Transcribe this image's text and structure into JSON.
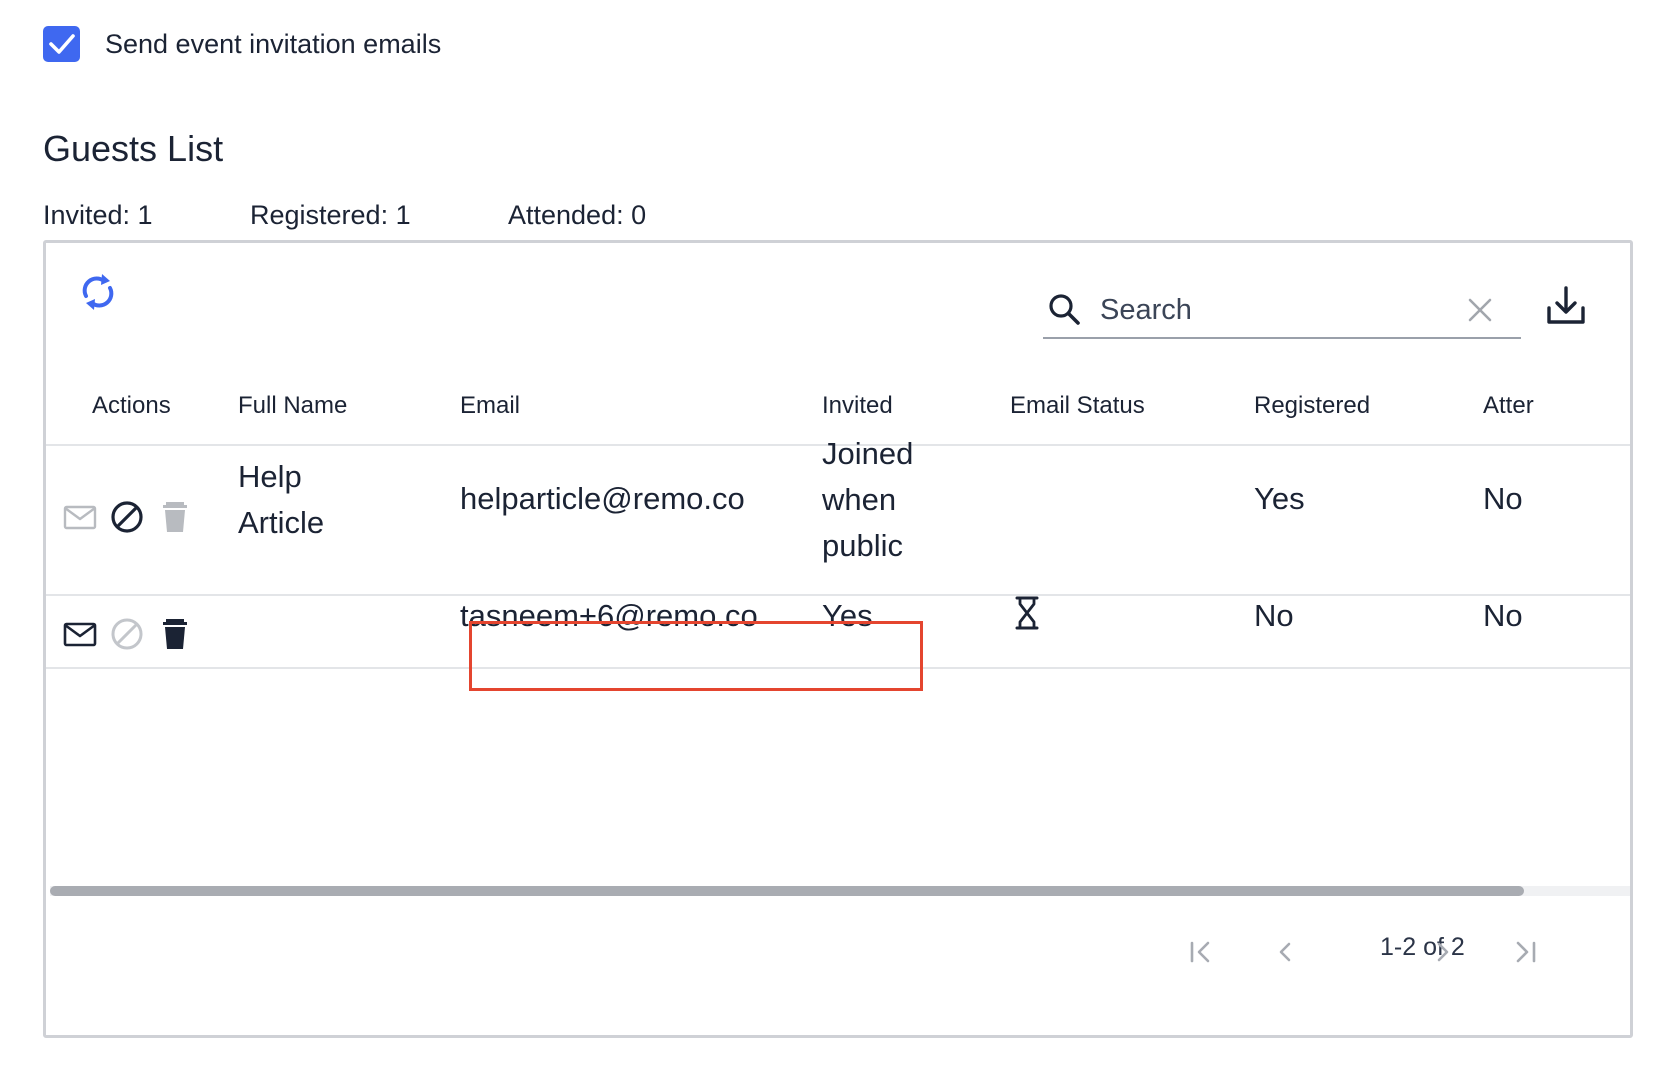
{
  "invitation": {
    "label": "Send event invitation emails",
    "checked": true
  },
  "guests": {
    "title": "Guests List",
    "stats": {
      "invited": "Invited: 1",
      "registered": "Registered: 1",
      "attended": "Attended: 0"
    }
  },
  "toolbar": {
    "refresh_icon": "refresh-icon",
    "search_placeholder": "Search",
    "clear_icon": "close-icon",
    "download_icon": "download-icon"
  },
  "table": {
    "columns": [
      "Actions",
      "Full Name",
      "Email",
      "Invited",
      "Email Status",
      "Registered",
      "Atter"
    ],
    "rows": [
      {
        "full_name_line1": "Help",
        "full_name_line2": "Article",
        "email": "helparticle@remo.co",
        "invited_line1": "Joined",
        "invited_line2": "when",
        "invited_line3": "public",
        "email_status": "",
        "registered": "Yes",
        "attended": "No",
        "actions": [
          "mail-icon (disabled)",
          "block-icon",
          "trash-icon (disabled)"
        ]
      },
      {
        "full_name": "",
        "email": "tasneem+6@remo.co",
        "invited": "Yes",
        "email_status_icon": "hourglass-icon",
        "registered": "No",
        "attended": "No",
        "actions": [
          "mail-icon",
          "block-icon (disabled)",
          "trash-icon"
        ]
      }
    ]
  },
  "pagination": {
    "range": "1-2 of 2"
  },
  "colors": {
    "accent": "#3f68f0",
    "highlight_border": "#e4452f",
    "text": "#1b2334",
    "disabled_icon": "#b8bbc0"
  }
}
